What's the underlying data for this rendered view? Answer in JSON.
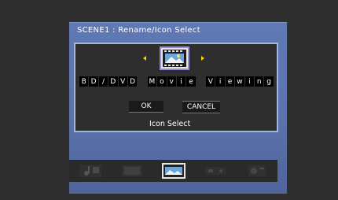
{
  "dialog": {
    "title": "SCENE1 : Rename/Icon Select",
    "name_chars": [
      "B",
      "D",
      "/",
      "D",
      "V",
      "D",
      " ",
      "M",
      "o",
      "v",
      "i",
      "e",
      " ",
      "V",
      "i",
      "e",
      "w",
      "i",
      "n",
      "g"
    ],
    "ok_label": "OK",
    "cancel_label": "CANCEL",
    "icon_select_label": "Icon Select",
    "selected_icon": "movie-film-icon"
  },
  "icon_strip": [
    {
      "name": "music-icon",
      "selected": false
    },
    {
      "name": "tv-icon",
      "selected": false
    },
    {
      "name": "movie-film-icon",
      "selected": true
    },
    {
      "name": "game-icon",
      "selected": false
    },
    {
      "name": "radio-icon",
      "selected": false
    }
  ],
  "colors": {
    "panel": "#5f79b5",
    "arrow": "#ffd200",
    "selection": "#9b8cd9"
  }
}
